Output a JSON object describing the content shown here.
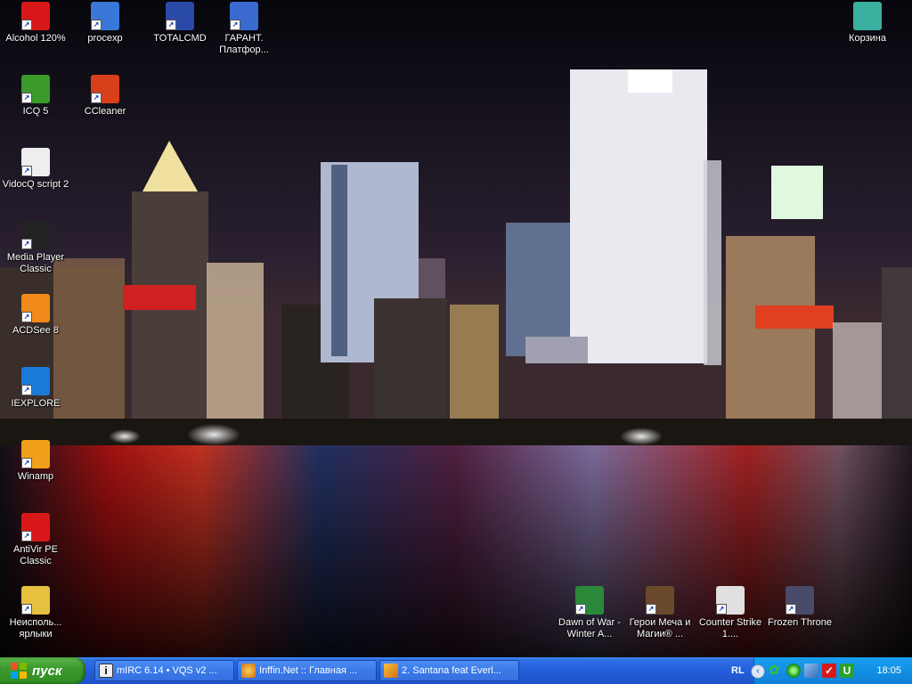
{
  "desktop": {
    "icons": [
      {
        "key": "alcohol",
        "label": "Alcohol 120%",
        "color": "#d81818"
      },
      {
        "key": "procexp",
        "label": "procexp",
        "color": "#3a78d8"
      },
      {
        "key": "totalcmd",
        "label": "TOTALCMD",
        "color": "#2a4aa8"
      },
      {
        "key": "garant",
        "label": "ГАРАНТ. Платфор...",
        "color": "#3a6ad0"
      },
      {
        "key": "recycle",
        "label": "Корзина",
        "color": "#3ab0a0"
      },
      {
        "key": "icq",
        "label": "ICQ 5",
        "color": "#3a9a2a"
      },
      {
        "key": "ccleaner",
        "label": "CCleaner",
        "color": "#d8401a"
      },
      {
        "key": "vidocq",
        "label": "VidocQ script 2",
        "color": "#eeeeee"
      },
      {
        "key": "mpc",
        "label": "Media Player Classic",
        "color": "#222222"
      },
      {
        "key": "acdsee",
        "label": "ACDSee 8",
        "color": "#f08a1a"
      },
      {
        "key": "iexplore",
        "label": "IEXPLORE",
        "color": "#1a7ad8"
      },
      {
        "key": "winamp",
        "label": "Winamp",
        "color": "#f0a01a"
      },
      {
        "key": "antivir",
        "label": "AntiVir PE Classic",
        "color": "#d81818"
      },
      {
        "key": "unused",
        "label": "Неисполь... ярлыки",
        "color": "#e8c040"
      },
      {
        "key": "dow",
        "label": "Dawn of War - Winter A...",
        "color": "#2a8a3a"
      },
      {
        "key": "heroes",
        "label": "Герои Меча и Магии® ...",
        "color": "#6a4a2a"
      },
      {
        "key": "cs",
        "label": "Counter Strike 1....",
        "color": "#e0e0e0"
      },
      {
        "key": "frozen",
        "label": "Frozen Throne",
        "color": "#4a4a6a"
      }
    ]
  },
  "taskbar": {
    "start_label": "пуск",
    "tasks": [
      {
        "label": "mIRC 6.14 • VQS v2 ...",
        "icon": "mirc-icon",
        "color": "#f0f0f0"
      },
      {
        "label": "Inffin.Net :: Главная ...",
        "icon": "browser-icon",
        "color": "#e8a030"
      },
      {
        "label": "2. Santana feat Everl...",
        "icon": "winamp-icon",
        "color": "#f0a01a"
      }
    ],
    "tray": {
      "lang": "RL",
      "clock": "18:05"
    }
  },
  "colors": {
    "taskbar_blue": "#245edc",
    "start_green": "#3d9a2e",
    "tray_blue": "#1290e4"
  }
}
